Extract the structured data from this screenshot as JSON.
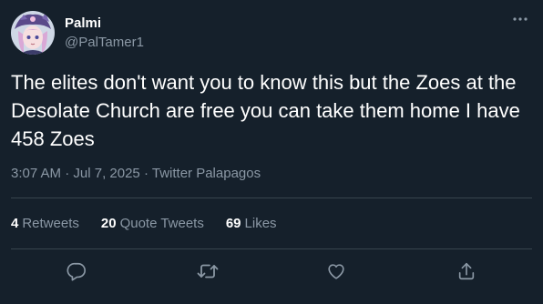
{
  "user": {
    "display_name": "Palmi",
    "handle": "@PalTamer1",
    "avatar_icon": "anime-character-avatar"
  },
  "tweet": {
    "text": "The elites don't want you to know this but the Zoes at the Desolate Church are free you can take them home I have 458 Zoes",
    "time": "3:07 AM",
    "date": "Jul 7, 2025",
    "source": "Twitter Palapagos",
    "separator": "·"
  },
  "stats": {
    "retweets_count": "4",
    "retweets_label": "Retweets",
    "quotes_count": "20",
    "quotes_label": "Quote Tweets",
    "likes_count": "69",
    "likes_label": "Likes"
  },
  "actions": {
    "reply_icon": "reply-icon",
    "retweet_icon": "retweet-icon",
    "like_icon": "heart-icon",
    "share_icon": "share-icon",
    "more_icon": "more-icon"
  },
  "colors": {
    "background": "#15202b",
    "primary_text": "#ffffff",
    "secondary_text": "#8b98a5",
    "divider": "#38444d"
  }
}
